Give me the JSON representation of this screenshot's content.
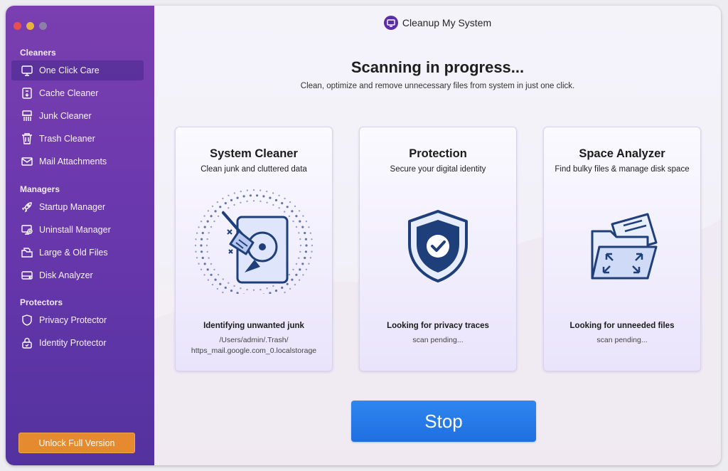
{
  "app": {
    "title": "Cleanup My System"
  },
  "sidebar": {
    "sections": [
      {
        "label": "Cleaners",
        "items": [
          {
            "label": "One Click Care",
            "icon": "monitor-icon",
            "active": true
          },
          {
            "label": "Cache Cleaner",
            "icon": "cache-icon"
          },
          {
            "label": "Junk Cleaner",
            "icon": "shredder-icon"
          },
          {
            "label": "Trash Cleaner",
            "icon": "trash-icon"
          },
          {
            "label": "Mail Attachments",
            "icon": "mail-icon"
          }
        ]
      },
      {
        "label": "Managers",
        "items": [
          {
            "label": "Startup Manager",
            "icon": "rocket-icon"
          },
          {
            "label": "Uninstall Manager",
            "icon": "uninstall-icon"
          },
          {
            "label": "Large & Old Files",
            "icon": "folder-files-icon"
          },
          {
            "label": "Disk Analyzer",
            "icon": "disk-icon"
          }
        ]
      },
      {
        "label": "Protectors",
        "items": [
          {
            "label": "Privacy Protector",
            "icon": "shield-icon"
          },
          {
            "label": "Identity Protector",
            "icon": "lock-icon"
          }
        ]
      }
    ],
    "unlock_label": "Unlock Full Version"
  },
  "main": {
    "heading": "Scanning in progress...",
    "subheading": "Clean, optimize and remove unnecessary files from system in just one click.",
    "cards": [
      {
        "title": "System Cleaner",
        "subtitle": "Clean junk and cluttered data",
        "status": "Identifying unwanted junk",
        "detail_1": "/Users/admin/.Trash/",
        "detail_2": "https_mail.google.com_0.localstorage",
        "icon": "hard-drive-broom-icon"
      },
      {
        "title": "Protection",
        "subtitle": "Secure your digital identity",
        "status": "Looking for privacy traces",
        "detail_1": "scan pending...",
        "icon": "shield-check-icon"
      },
      {
        "title": "Space Analyzer",
        "subtitle": "Find bulky files & manage disk space",
        "status": "Looking for unneeded files",
        "detail_1": "scan pending...",
        "icon": "folder-expand-icon"
      }
    ],
    "stop_label": "Stop"
  },
  "colors": {
    "sidebar_top": "#7a3fb0",
    "sidebar_bottom": "#53329f",
    "accent_blue": "#1f6fe0",
    "unlock_orange": "#e58a2e",
    "icon_navy": "#1e3f7a"
  }
}
